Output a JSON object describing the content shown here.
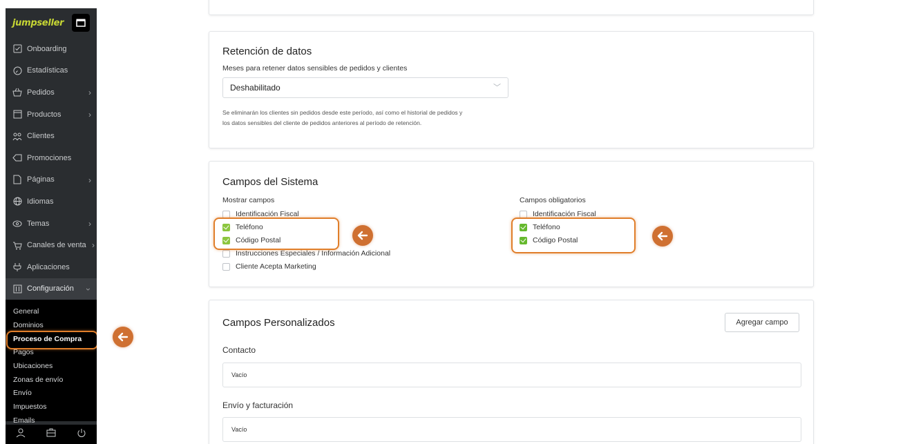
{
  "sidebar": {
    "logo": "jumpseller",
    "items": [
      {
        "label": "Onboarding",
        "icon": "checkbox-icon",
        "chevron": false
      },
      {
        "label": "Estadísticas",
        "icon": "gauge-icon",
        "chevron": false
      },
      {
        "label": "Pedidos",
        "icon": "basket-icon",
        "chevron": true
      },
      {
        "label": "Productos",
        "icon": "box-icon",
        "chevron": true
      },
      {
        "label": "Clientes",
        "icon": "users-icon",
        "chevron": false
      },
      {
        "label": "Promociones",
        "icon": "tag-icon",
        "chevron": false
      },
      {
        "label": "Páginas",
        "icon": "page-icon",
        "chevron": true
      },
      {
        "label": "Idiomas",
        "icon": "globe-icon",
        "chevron": false
      },
      {
        "label": "Temas",
        "icon": "eye-icon",
        "chevron": true
      },
      {
        "label": "Canales de venta",
        "icon": "cart-icon",
        "chevron": true
      },
      {
        "label": "Aplicaciones",
        "icon": "plug-icon",
        "chevron": false
      },
      {
        "label": "Configuración",
        "icon": "sliders-icon",
        "chevron": true
      }
    ],
    "submenu": [
      "General",
      "Dominios",
      "Proceso de Compra",
      "Pagos",
      "Ubicaciones",
      "Zonas de envío",
      "Envío",
      "Impuestos",
      "Emails"
    ],
    "current_submenu": "Proceso de Compra"
  },
  "retention": {
    "title": "Retención de datos",
    "field_label": "Meses para retener datos sensibles de pedidos y clientes",
    "selected": "Deshabilitado",
    "help_line1": "Se eliminarán los clientes sin pedidos desde este período, así como el historial de pedidos y",
    "help_line2": "los datos sensibles del cliente de pedidos anteriores al período de retención."
  },
  "system_fields": {
    "title": "Campos del Sistema",
    "show_label": "Mostrar campos",
    "required_label": "Campos obligatorios",
    "show": [
      {
        "label": "Identificación Fiscal",
        "checked": false
      },
      {
        "label": "Teléfono",
        "checked": true
      },
      {
        "label": "Código Postal",
        "checked": true
      },
      {
        "label": "Instrucciones Especiales / Información Adicional",
        "checked": false
      },
      {
        "label": "Cliente Acepta Marketing",
        "checked": false
      }
    ],
    "required": [
      {
        "label": "Identificación Fiscal",
        "checked": false
      },
      {
        "label": "Teléfono",
        "checked": true
      },
      {
        "label": "Código Postal",
        "checked": true
      }
    ]
  },
  "custom_fields": {
    "title": "Campos Personalizados",
    "add_button": "Agregar campo",
    "sections": [
      {
        "title": "Contacto",
        "value": "Vacío"
      },
      {
        "title": "Envío y facturación",
        "value": "Vacío"
      }
    ]
  },
  "colors": {
    "sidebar_bg": "#2a2d30",
    "accent_orange": "#cf7031",
    "checkbox_green": "#8cc63f"
  }
}
